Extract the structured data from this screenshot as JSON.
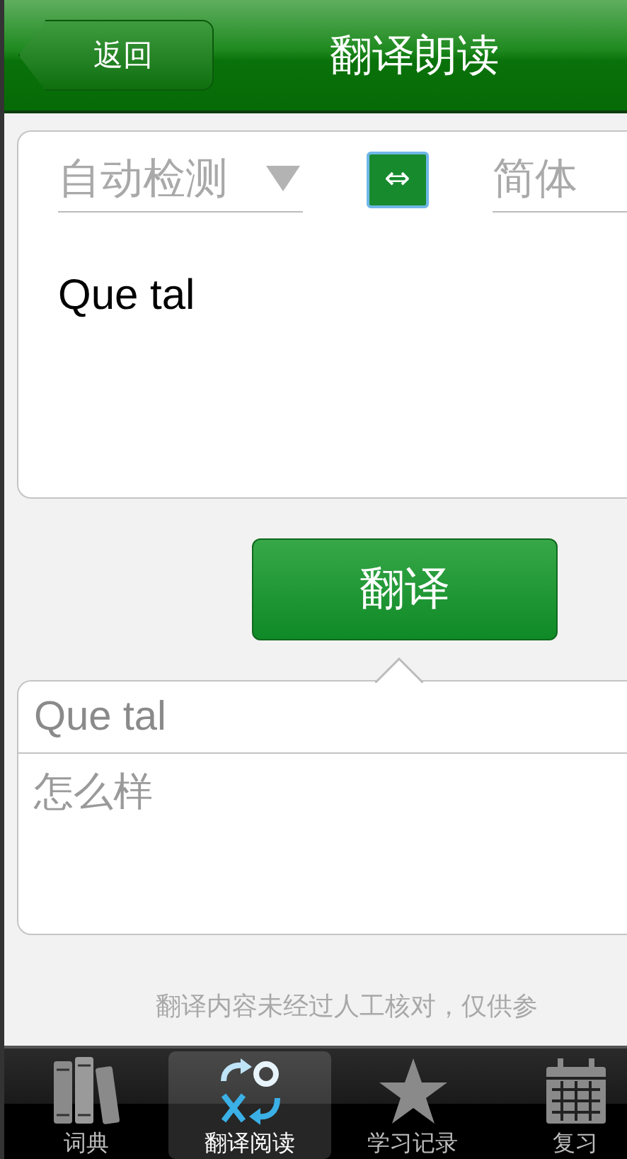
{
  "nav": {
    "back": "返回",
    "title": "翻译朗读"
  },
  "source_language": {
    "label": "自动检测"
  },
  "swap": "⇔",
  "target_language": {
    "label": "简体"
  },
  "input": {
    "value": "Que tal"
  },
  "translate_button": "翻译",
  "result": {
    "source": "Que tal",
    "translation": "怎么样"
  },
  "disclaimer": "翻译内容未经过人工核对，仅供参",
  "tabs": [
    {
      "label": "词典",
      "kind": "books",
      "selected": false
    },
    {
      "label": "翻译阅读",
      "kind": "translate",
      "selected": true
    },
    {
      "label": "学习记录",
      "kind": "star",
      "selected": false
    },
    {
      "label": "复习",
      "kind": "calendar",
      "selected": false
    }
  ]
}
